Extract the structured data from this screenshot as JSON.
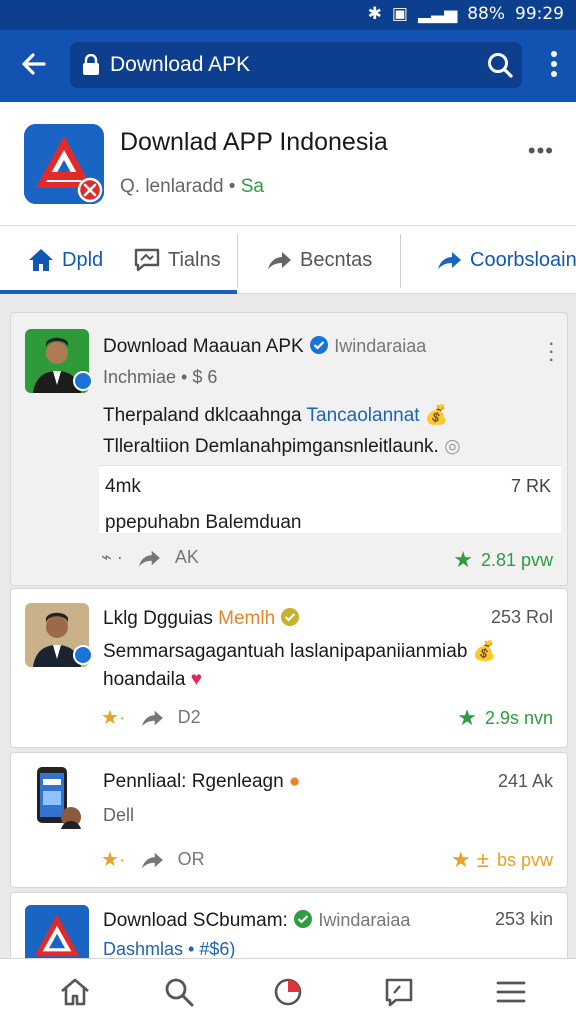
{
  "status_bar": {
    "battery": "88%",
    "time": "99:29"
  },
  "app_bar": {
    "url_text": "Download APK"
  },
  "app_header": {
    "title": "Downlad APP Indonesia",
    "subtitle": "Q. lenlaradd",
    "subtitle_dot": "•",
    "status": "Sa",
    "more": "•••"
  },
  "tabs": [
    {
      "label": "Dpld"
    },
    {
      "label": "Tialns"
    },
    {
      "label": "Becntas"
    },
    {
      "label": "Coorbsloain"
    }
  ],
  "posts": [
    {
      "name": "Download Maauan APK",
      "handle": "Iwindaraiaa",
      "meta": "Inchmiae • $ 6",
      "line1": "Therpaland dklcaahnga ",
      "line1_blue": "Tancaolannat",
      "line2": "Tlleraltiion Demlanahpimgansnleitlaunk.",
      "quote_left": "4mk",
      "quote_right": "7 RK",
      "quote_text": "ppepuhabn Balemduan",
      "action_count": "AK",
      "time": "2.81 pvw"
    },
    {
      "name": "Lklg Dgguias",
      "name_orange": "Memlh",
      "count": "253 Rol",
      "line1": "Semmarsagagantuah laslanipapaniianmiab",
      "line2": "hoandaila",
      "action_count": "D2",
      "time": "2.9s nvn"
    },
    {
      "name": "Pennliaal: Rgenleagn",
      "count": "241 Ak",
      "meta": "Dell",
      "action_count": "OR",
      "time": "bs pvw"
    },
    {
      "name": "Download SCbumam:",
      "handle": "Iwindaraiaa",
      "count": "253 kin",
      "meta": "Dashmlas • #$6)"
    }
  ],
  "colors": {
    "primary": "#1253b2",
    "status_bar": "#0d3f8f",
    "green": "#2e9c3f",
    "orange": "#e8842a"
  }
}
